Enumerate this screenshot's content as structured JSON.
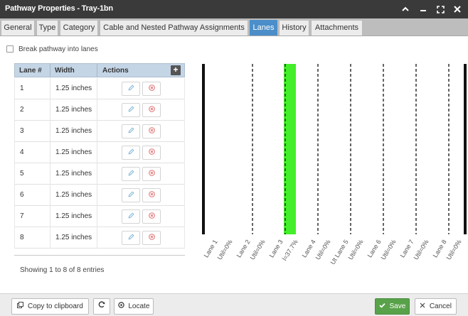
{
  "window": {
    "title": "Pathway Properties - Tray-1bn",
    "buttons": {
      "collapse": "▲",
      "minimize": "‒",
      "maximize": "⤢",
      "close": "✕"
    }
  },
  "tabs": [
    {
      "label": "General"
    },
    {
      "label": "Type"
    },
    {
      "label": "Category"
    },
    {
      "label": "Cable and Nested Pathway Assignments"
    },
    {
      "label": "Lanes",
      "active": true
    },
    {
      "label": "History"
    },
    {
      "label": "Attachments"
    }
  ],
  "options": {
    "break_lanes_label": "Break pathway into lanes",
    "break_lanes_checked": false
  },
  "table": {
    "columns": [
      "Lane #",
      "Width",
      "Actions"
    ],
    "add_icon": "+",
    "rows": [
      {
        "lane": "1",
        "width": "1.25 inches"
      },
      {
        "lane": "2",
        "width": "1.25 inches"
      },
      {
        "lane": "3",
        "width": "1.25 inches"
      },
      {
        "lane": "4",
        "width": "1.25 inches"
      },
      {
        "lane": "5",
        "width": "1.25 inches"
      },
      {
        "lane": "6",
        "width": "1.25 inches"
      },
      {
        "lane": "7",
        "width": "1.25 inches"
      },
      {
        "lane": "8",
        "width": "1.25 inches"
      }
    ],
    "edit_icon": "pencil-icon",
    "delete_icon": "remove-circle-icon",
    "summary": "Showing 1 to 8 of 8 entries"
  },
  "lane_diagram": {
    "lanes": [
      {
        "name": "Lane 1",
        "util": "Util=0%"
      },
      {
        "name": "Lane 2",
        "util": "Util=0%"
      },
      {
        "name": "Lane 3",
        "util": "Util=37.7%",
        "util_display": "l=37.7%",
        "highlight": true
      },
      {
        "name": "Lane 4",
        "util": "Util=0%"
      },
      {
        "name": "Lane 5",
        "util": "Util=0%",
        "name_display": "Ut Lane 5"
      },
      {
        "name": "Lane 6",
        "util": "Util=0%"
      },
      {
        "name": "Lane 7",
        "util": "Util=0%"
      },
      {
        "name": "Lane 8",
        "util": "Util=0%"
      }
    ],
    "highlight_color": "#44ee2a"
  },
  "footer": {
    "copy_label": "Copy to clipboard",
    "refresh_icon": "refresh-icon",
    "locate_label": "Locate",
    "save_label": "Save",
    "cancel_label": "Cancel"
  }
}
